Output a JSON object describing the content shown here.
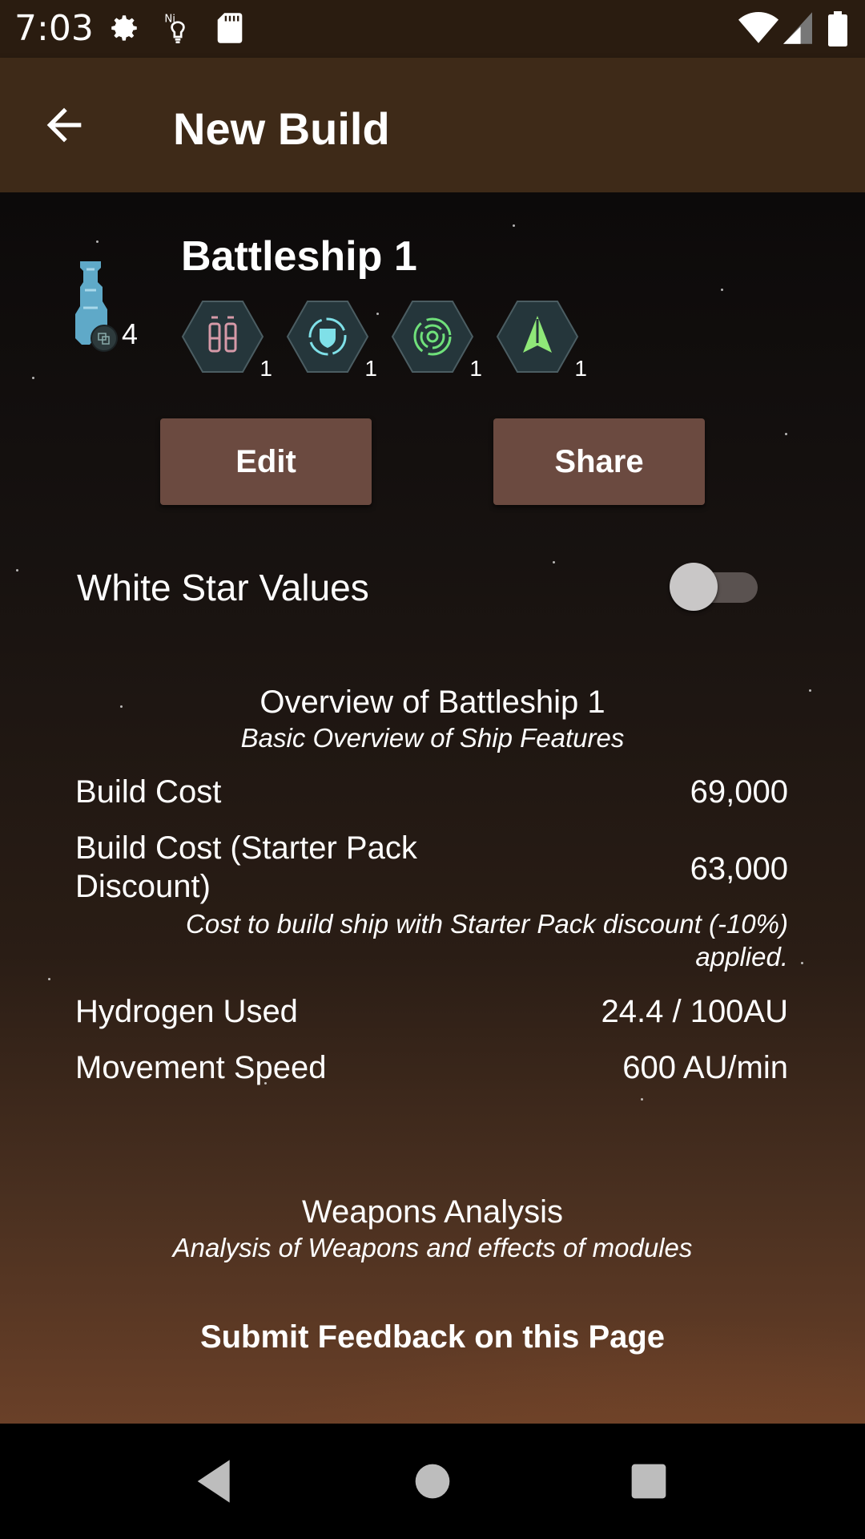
{
  "status_bar": {
    "time": "7:03",
    "icons": [
      "gear-icon",
      "bulb-icon",
      "sd-card-icon",
      "wifi-icon",
      "signal-icon",
      "battery-icon"
    ]
  },
  "app_bar": {
    "title": "New Build",
    "back_icon": "arrow-left-icon"
  },
  "ship": {
    "name": "Battleship 1",
    "level": "4",
    "modules": [
      {
        "icon": "weapon-module-icon",
        "count": "1"
      },
      {
        "icon": "shield-module-icon",
        "count": "1"
      },
      {
        "icon": "support-module-icon",
        "count": "1"
      },
      {
        "icon": "drone-module-icon",
        "count": "1"
      }
    ]
  },
  "actions": {
    "edit_label": "Edit",
    "share_label": "Share"
  },
  "toggle": {
    "label": "White Star Values",
    "enabled": false
  },
  "overview": {
    "title": "Overview of Battleship 1",
    "subtitle": "Basic Overview of Ship Features",
    "build_cost_label": "Build Cost",
    "build_cost_value": "69,000",
    "starter_cost_label_line1": "Build Cost (Starter Pack",
    "starter_cost_label_line2": "Discount)",
    "starter_cost_value": "63,000",
    "starter_note_line1": "Cost to build ship with Starter Pack discount (-10%)",
    "starter_note_line2": "applied.",
    "hydrogen_label": "Hydrogen Used",
    "hydrogen_value": "24.4 / 100AU",
    "speed_label": "Movement Speed",
    "speed_value": "600 AU/min"
  },
  "weapons": {
    "title": "Weapons Analysis",
    "subtitle": "Analysis of Weapons and effects of modules"
  },
  "feedback_label": "Submit Feedback on this Page",
  "colors": {
    "status_bar": "#2a1c10",
    "app_bar": "#3e2a18",
    "button": "#6b4a40",
    "weapon": "#d69aa8",
    "shield": "#7fe0e8",
    "support": "#6fe07a",
    "drone": "#8fe878"
  }
}
